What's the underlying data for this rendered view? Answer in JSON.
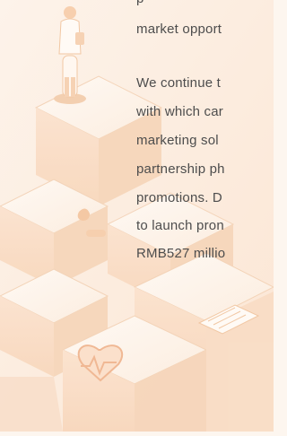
{
  "paragraph_1": {
    "lines": [
      "p",
      "market opport"
    ]
  },
  "paragraph_2": {
    "lines": [
      "We continue t",
      "with which car",
      "marketing sol",
      "partnership ph",
      "promotions. D",
      "to launch pron",
      "RMB527 millio"
    ]
  }
}
